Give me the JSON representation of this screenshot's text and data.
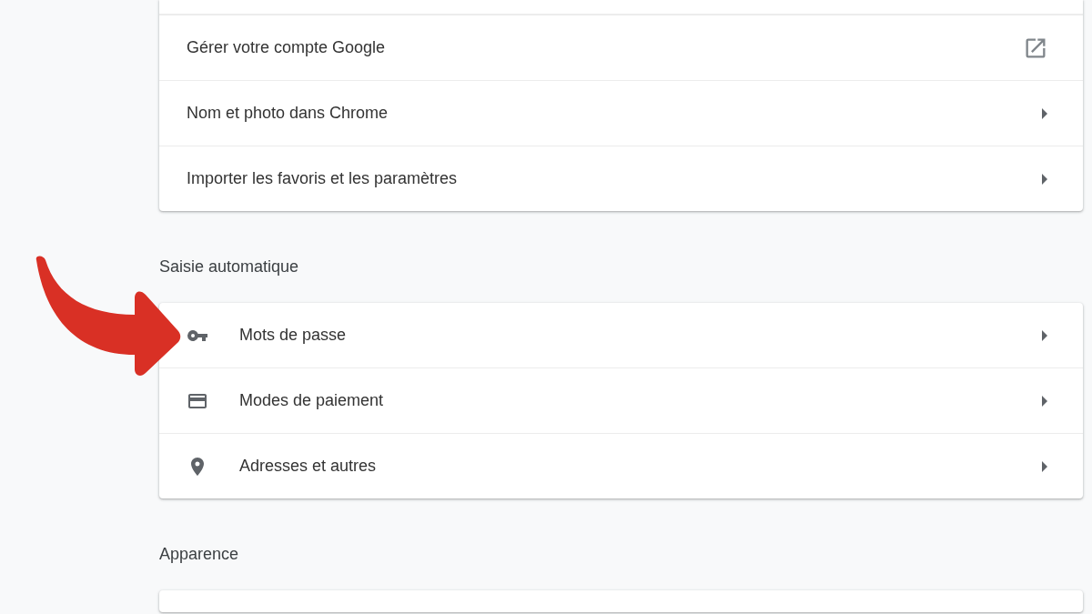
{
  "sections": [
    {
      "rows": [
        {
          "label": "Gérer votre compte Google",
          "kind": "external"
        },
        {
          "label": "Nom et photo dans Chrome",
          "kind": "submenu"
        },
        {
          "label": "Importer les favoris et les paramètres",
          "kind": "submenu"
        }
      ]
    },
    {
      "title": "Saisie automatique",
      "kind": "with-icons",
      "rows": [
        {
          "label": "Mots de passe",
          "kind": "submenu"
        },
        {
          "label": "Modes de paiement",
          "kind": "submenu"
        },
        {
          "label": "Adresses et autres",
          "kind": "submenu"
        }
      ]
    },
    {
      "title": "Apparence"
    }
  ]
}
